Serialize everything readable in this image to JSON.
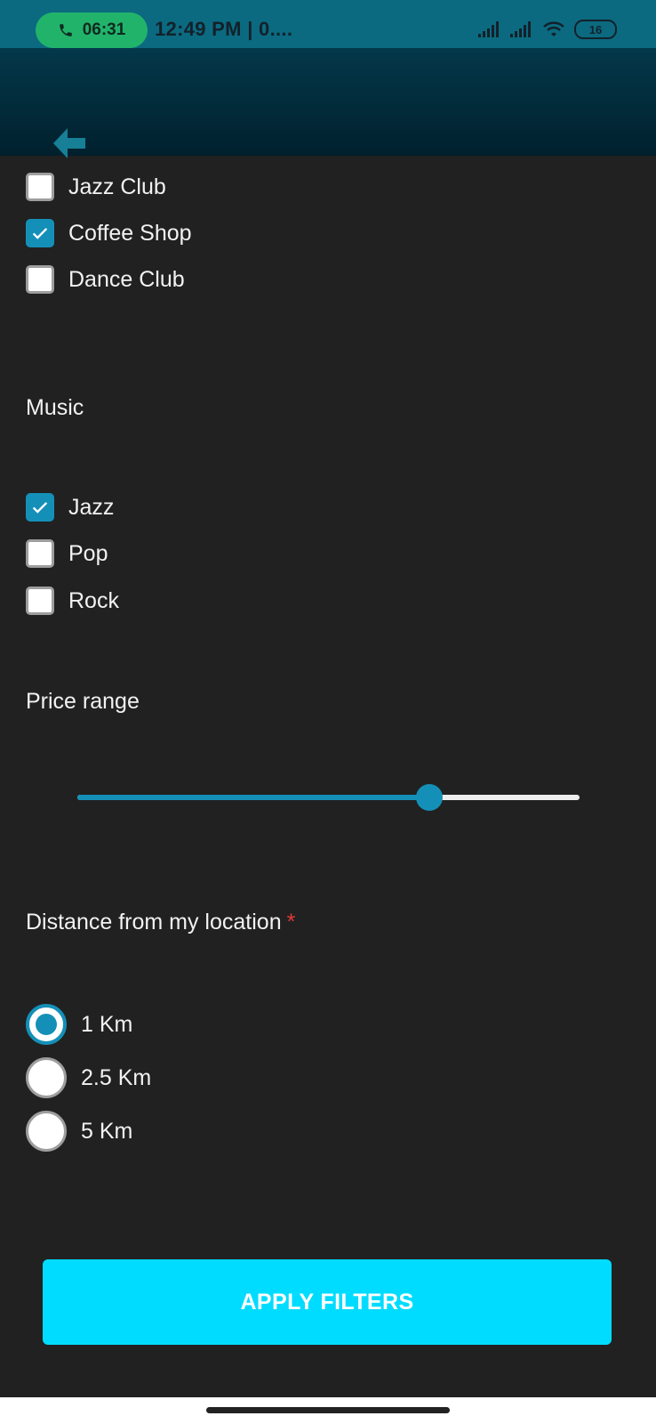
{
  "status_bar": {
    "call_timer": "06:31",
    "time_text": "12:49 PM | 0....",
    "battery": "16"
  },
  "venue_types": [
    {
      "label": "Jazz Club",
      "checked": false
    },
    {
      "label": "Coffee Shop",
      "checked": true
    },
    {
      "label": "Dance Club",
      "checked": false
    }
  ],
  "music": {
    "heading": "Music",
    "options": [
      {
        "label": "Jazz",
        "checked": true
      },
      {
        "label": "Pop",
        "checked": false
      },
      {
        "label": "Rock",
        "checked": false
      }
    ]
  },
  "price": {
    "heading": "Price range",
    "value_fraction": 0.7
  },
  "distance": {
    "heading": "Distance from my location",
    "required_mark": "*",
    "options": [
      {
        "label": "1 Km",
        "selected": true
      },
      {
        "label": "2.5 Km",
        "selected": false
      },
      {
        "label": "5 Km",
        "selected": false
      }
    ]
  },
  "apply_button": "APPLY FILTERS",
  "colors": {
    "accent": "#1490b8",
    "button": "#00dcff",
    "background": "#212121",
    "required": "#e53935"
  }
}
